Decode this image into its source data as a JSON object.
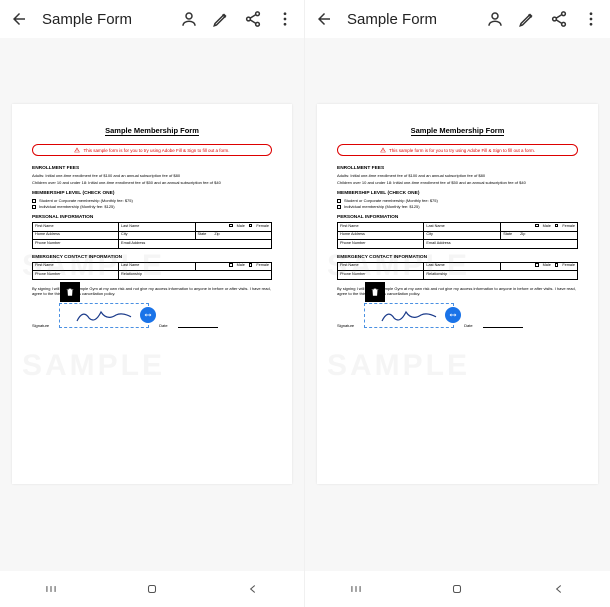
{
  "toolbar": {
    "title": "Sample Form"
  },
  "doc": {
    "title": "Sample Membership Form",
    "warning": "This sample form is for you to try using Adobe Fill & Sign to fill out a form.",
    "fees": {
      "heading": "ENROLLMENT FEES",
      "line1": "Adults: Initial one-time enrollment fee of $100 and an annual subscription fee of $80",
      "line2": "Children over 10 and under 18: Initial one-time enrollment fee of $50 and an annual subscription fee of $40"
    },
    "level": {
      "heading": "MEMBERSHIP LEVEL (CHECK ONE)",
      "opt1": "Student or Corporate membership (Monthly fee: $75)",
      "opt2": "Individual membership (Monthly fee: $125)"
    },
    "personal": {
      "heading": "PERSONAL INFORMATION",
      "first": "First Name",
      "last": "Last Name",
      "male": "Male",
      "female": "Female",
      "home": "Home Address",
      "city": "City",
      "state": "State",
      "zip": "Zip",
      "phone": "Phone Number",
      "email": "Email Address"
    },
    "emergency": {
      "heading": "EMERGENCY CONTACT INFORMATION",
      "first": "First Name",
      "last": "Last Name",
      "male": "Male",
      "female": "Female",
      "phone": "Phone Number",
      "rel": "Relationship"
    },
    "disclaimer": "By signing I will use the Sample Gym at my own risk and not give my access information to anyone in before or after visits. I have read, agree to the thirty (30) days cancellation policy.",
    "sign": "Signature",
    "date": "Date"
  }
}
